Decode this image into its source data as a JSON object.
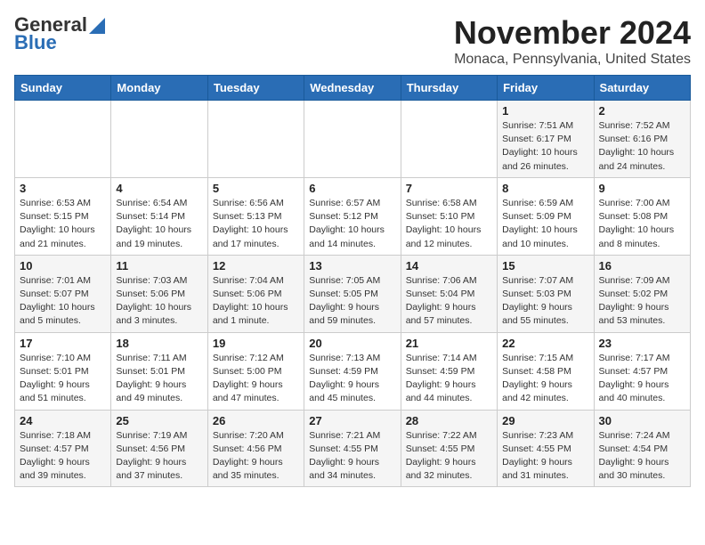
{
  "header": {
    "logo_line1": "General",
    "logo_line2": "Blue",
    "month": "November 2024",
    "location": "Monaca, Pennsylvania, United States"
  },
  "weekdays": [
    "Sunday",
    "Monday",
    "Tuesday",
    "Wednesday",
    "Thursday",
    "Friday",
    "Saturday"
  ],
  "weeks": [
    [
      {
        "day": "",
        "info": ""
      },
      {
        "day": "",
        "info": ""
      },
      {
        "day": "",
        "info": ""
      },
      {
        "day": "",
        "info": ""
      },
      {
        "day": "",
        "info": ""
      },
      {
        "day": "1",
        "info": "Sunrise: 7:51 AM\nSunset: 6:17 PM\nDaylight: 10 hours and 26 minutes."
      },
      {
        "day": "2",
        "info": "Sunrise: 7:52 AM\nSunset: 6:16 PM\nDaylight: 10 hours and 24 minutes."
      }
    ],
    [
      {
        "day": "3",
        "info": "Sunrise: 6:53 AM\nSunset: 5:15 PM\nDaylight: 10 hours and 21 minutes."
      },
      {
        "day": "4",
        "info": "Sunrise: 6:54 AM\nSunset: 5:14 PM\nDaylight: 10 hours and 19 minutes."
      },
      {
        "day": "5",
        "info": "Sunrise: 6:56 AM\nSunset: 5:13 PM\nDaylight: 10 hours and 17 minutes."
      },
      {
        "day": "6",
        "info": "Sunrise: 6:57 AM\nSunset: 5:12 PM\nDaylight: 10 hours and 14 minutes."
      },
      {
        "day": "7",
        "info": "Sunrise: 6:58 AM\nSunset: 5:10 PM\nDaylight: 10 hours and 12 minutes."
      },
      {
        "day": "8",
        "info": "Sunrise: 6:59 AM\nSunset: 5:09 PM\nDaylight: 10 hours and 10 minutes."
      },
      {
        "day": "9",
        "info": "Sunrise: 7:00 AM\nSunset: 5:08 PM\nDaylight: 10 hours and 8 minutes."
      }
    ],
    [
      {
        "day": "10",
        "info": "Sunrise: 7:01 AM\nSunset: 5:07 PM\nDaylight: 10 hours and 5 minutes."
      },
      {
        "day": "11",
        "info": "Sunrise: 7:03 AM\nSunset: 5:06 PM\nDaylight: 10 hours and 3 minutes."
      },
      {
        "day": "12",
        "info": "Sunrise: 7:04 AM\nSunset: 5:06 PM\nDaylight: 10 hours and 1 minute."
      },
      {
        "day": "13",
        "info": "Sunrise: 7:05 AM\nSunset: 5:05 PM\nDaylight: 9 hours and 59 minutes."
      },
      {
        "day": "14",
        "info": "Sunrise: 7:06 AM\nSunset: 5:04 PM\nDaylight: 9 hours and 57 minutes."
      },
      {
        "day": "15",
        "info": "Sunrise: 7:07 AM\nSunset: 5:03 PM\nDaylight: 9 hours and 55 minutes."
      },
      {
        "day": "16",
        "info": "Sunrise: 7:09 AM\nSunset: 5:02 PM\nDaylight: 9 hours and 53 minutes."
      }
    ],
    [
      {
        "day": "17",
        "info": "Sunrise: 7:10 AM\nSunset: 5:01 PM\nDaylight: 9 hours and 51 minutes."
      },
      {
        "day": "18",
        "info": "Sunrise: 7:11 AM\nSunset: 5:01 PM\nDaylight: 9 hours and 49 minutes."
      },
      {
        "day": "19",
        "info": "Sunrise: 7:12 AM\nSunset: 5:00 PM\nDaylight: 9 hours and 47 minutes."
      },
      {
        "day": "20",
        "info": "Sunrise: 7:13 AM\nSunset: 4:59 PM\nDaylight: 9 hours and 45 minutes."
      },
      {
        "day": "21",
        "info": "Sunrise: 7:14 AM\nSunset: 4:59 PM\nDaylight: 9 hours and 44 minutes."
      },
      {
        "day": "22",
        "info": "Sunrise: 7:15 AM\nSunset: 4:58 PM\nDaylight: 9 hours and 42 minutes."
      },
      {
        "day": "23",
        "info": "Sunrise: 7:17 AM\nSunset: 4:57 PM\nDaylight: 9 hours and 40 minutes."
      }
    ],
    [
      {
        "day": "24",
        "info": "Sunrise: 7:18 AM\nSunset: 4:57 PM\nDaylight: 9 hours and 39 minutes."
      },
      {
        "day": "25",
        "info": "Sunrise: 7:19 AM\nSunset: 4:56 PM\nDaylight: 9 hours and 37 minutes."
      },
      {
        "day": "26",
        "info": "Sunrise: 7:20 AM\nSunset: 4:56 PM\nDaylight: 9 hours and 35 minutes."
      },
      {
        "day": "27",
        "info": "Sunrise: 7:21 AM\nSunset: 4:55 PM\nDaylight: 9 hours and 34 minutes."
      },
      {
        "day": "28",
        "info": "Sunrise: 7:22 AM\nSunset: 4:55 PM\nDaylight: 9 hours and 32 minutes."
      },
      {
        "day": "29",
        "info": "Sunrise: 7:23 AM\nSunset: 4:55 PM\nDaylight: 9 hours and 31 minutes."
      },
      {
        "day": "30",
        "info": "Sunrise: 7:24 AM\nSunset: 4:54 PM\nDaylight: 9 hours and 30 minutes."
      }
    ]
  ]
}
